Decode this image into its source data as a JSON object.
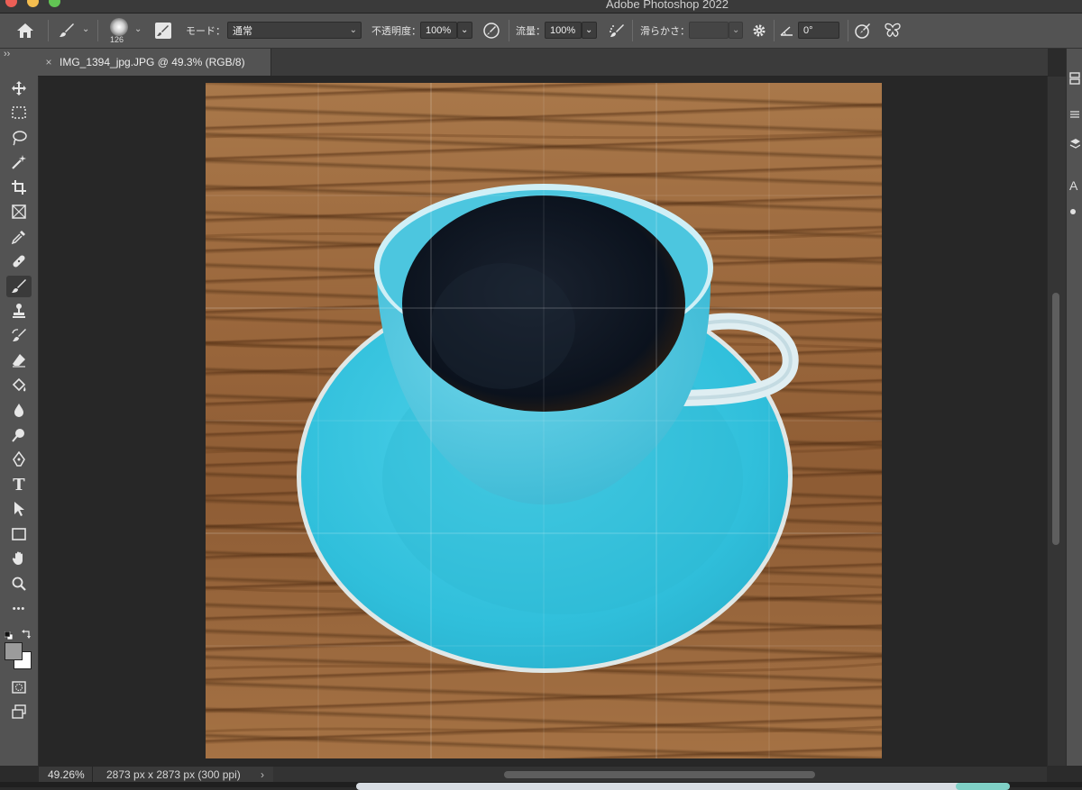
{
  "window": {
    "app_title": "Adobe Photoshop 2022"
  },
  "options_bar": {
    "brush_size": "126",
    "mode_label": "モード：",
    "mode_value": "通常",
    "opacity_label": "不透明度：",
    "opacity_value": "100%",
    "flow_label": "流量：",
    "flow_value": "100%",
    "smoothing_label": "滑らかさ：",
    "smoothing_value": "",
    "angle_value": "0°"
  },
  "document_tab": {
    "close_glyph": "×",
    "title": "IMG_1394_jpg.JPG @ 49.3% (RGB/8)"
  },
  "toolbar": {
    "collapse_glyph": "››",
    "more_glyph": "•••",
    "tools": [
      "move-tool",
      "marquee-tool",
      "lasso-tool",
      "magic-wand-tool",
      "crop-tool",
      "frame-tool",
      "eyedropper-tool",
      "healing-brush-tool",
      "brush-tool",
      "clone-stamp-tool",
      "history-brush-tool",
      "eraser-tool",
      "paint-bucket-tool",
      "blur-tool",
      "dodge-tool",
      "pen-tool",
      "type-tool",
      "path-selection-tool",
      "rectangle-tool",
      "hand-tool",
      "zoom-tool"
    ],
    "active_tool": "brush-tool",
    "type_glyph": "T",
    "colors": {
      "foreground": "#9b9b9b",
      "background": "#ffffff"
    }
  },
  "right_panel": {
    "glyph_a": "A"
  },
  "status_bar": {
    "zoom": "49.26%",
    "doc_info": "2873 px x 2873 px (300 ppi)",
    "chevron": "›"
  },
  "colors": {
    "saucer": "#35c3dd",
    "cup": "#46bfd9",
    "coffee": "#0d1420",
    "wood": "#9a673c"
  }
}
